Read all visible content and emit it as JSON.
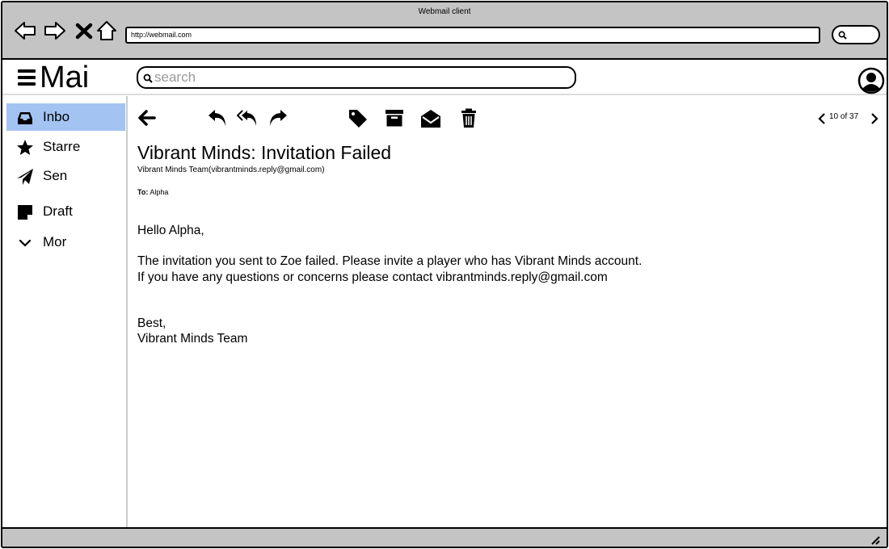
{
  "window": {
    "title": "Webmail client"
  },
  "browser": {
    "url": "http://webmail.com",
    "nav": [
      "back-icon",
      "forward-icon",
      "stop-icon",
      "home-icon"
    ],
    "search_icon": "search-icon"
  },
  "app": {
    "logo": "Mai",
    "search_placeholder": "search",
    "avatar_icon": "user-avatar-icon"
  },
  "sidebar": {
    "items": [
      {
        "label": "Inbo",
        "icon": "inbox-icon",
        "active": true
      },
      {
        "label": "Starre",
        "icon": "star-icon",
        "active": false
      },
      {
        "label": "Sen",
        "icon": "send-icon",
        "active": false
      },
      {
        "label": "Draft",
        "icon": "draft-icon",
        "active": false
      },
      {
        "label": "Mor",
        "icon": "chevron-down-icon",
        "active": false
      }
    ]
  },
  "toolbar": {
    "icons": [
      "back-arrow-icon",
      "reply-icon",
      "reply-all-icon",
      "forward-icon",
      "tag-icon",
      "archive-icon",
      "mark-read-icon",
      "trash-icon"
    ],
    "pager": "10 of 37"
  },
  "email": {
    "subject": "Vibrant Minds: Invitation Failed",
    "sender": "Vibrant Minds Team(vibrantminds.reply@gmail.com)",
    "to_label": "To:",
    "to_value": "Alpha",
    "body": [
      "Hello Alpha,",
      "The invitation you sent to Zoe failed. Please invite a player who has Vibrant Minds account.",
      "If you have any questions or concerns please contact vibrantminds.reply@gmail.com",
      "Best,",
      "Vibrant Minds Team"
    ]
  },
  "colors": {
    "chrome": "#c4c4c4",
    "active_item": "#a3c4f3"
  }
}
